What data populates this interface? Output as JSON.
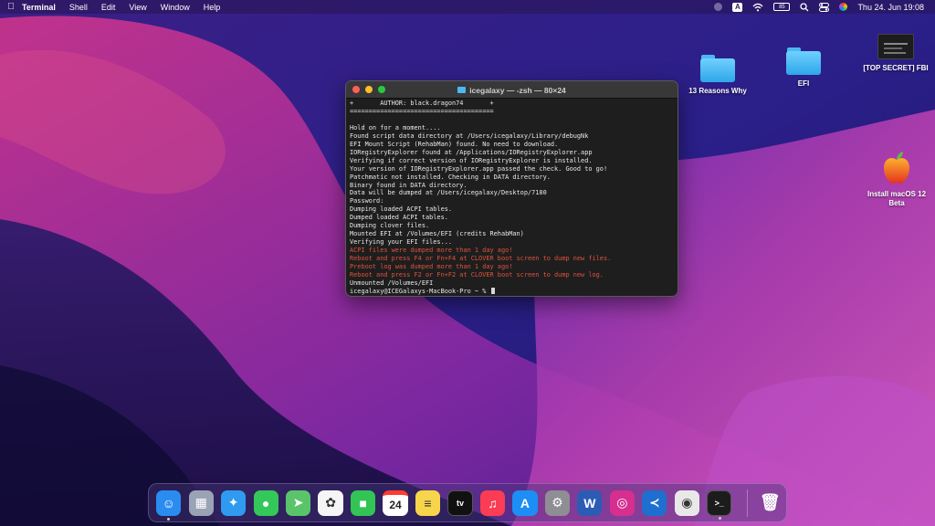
{
  "menubar": {
    "app_name": "Terminal",
    "items": [
      "Shell",
      "Edit",
      "View",
      "Window",
      "Help"
    ],
    "clock": "Thu 24. Jun  19:08",
    "input_source": "A",
    "battery": "85"
  },
  "desktop": {
    "icons": [
      {
        "label": "13 Reasons Why",
        "icon": "folder-icon"
      },
      {
        "label": "EFI",
        "icon": "folder-icon"
      },
      {
        "label": "[TOP SECRET] FBI",
        "icon": "screenshot-thumbnail-icon"
      },
      {
        "label": "Install macOS 12 Beta",
        "icon": "macos-installer-icon"
      }
    ]
  },
  "terminal": {
    "title": "icegalaxy — -zsh — 80×24",
    "lines": [
      {
        "text": "+       AUTHOR: black.dragon74       +",
        "color": "normal"
      },
      {
        "text": "======================================",
        "color": "normal"
      },
      {
        "text": "",
        "color": "normal"
      },
      {
        "text": "Hold on for a moment....",
        "color": "normal"
      },
      {
        "text": "Found script data directory at /Users/icegalaxy/Library/debugNk",
        "color": "normal"
      },
      {
        "text": "EFI Mount Script (RehabMan) found. No need to download.",
        "color": "normal"
      },
      {
        "text": "IORegistryExplorer found at /Applications/IORegistryExplorer.app",
        "color": "normal"
      },
      {
        "text": "Verifying if correct version of IORegistryExplorer is installed.",
        "color": "normal"
      },
      {
        "text": "Your version of IORegistryExplorer.app passed the check. Good to go!",
        "color": "normal"
      },
      {
        "text": "Patchmatic not installed. Checking in DATA directory.",
        "color": "normal"
      },
      {
        "text": "Binary found in DATA directory.",
        "color": "normal"
      },
      {
        "text": "Data will be dumped at /Users/icegalaxy/Desktop/7180",
        "color": "normal"
      },
      {
        "text": "Password:",
        "color": "normal"
      },
      {
        "text": "Dumping loaded ACPI tables.",
        "color": "normal"
      },
      {
        "text": "Dumped loaded ACPI tables.",
        "color": "normal"
      },
      {
        "text": "Dumping clover files.",
        "color": "normal"
      },
      {
        "text": "Mounted EFI at /Volumes/EFI (credits RehabMan)",
        "color": "normal"
      },
      {
        "text": "Verifying your EFI files...",
        "color": "normal"
      },
      {
        "text": "ACPI files were dumped more than 1 day ago!",
        "color": "red"
      },
      {
        "text": "Reboot and press F4 or Fn+F4 at CLOVER boot screen to dump new files.",
        "color": "red"
      },
      {
        "text": "Preboot log was dumped more than 1 day ago!",
        "color": "red"
      },
      {
        "text": "Reboot and press F2 or Fn+F2 at CLOVER boot screen to dump new log.",
        "color": "red"
      },
      {
        "text": "Unmounted /Volumes/EFI",
        "color": "normal"
      }
    ],
    "prompt": "icegalaxy@ICEGalaxys-MacBook-Pro ~ %"
  },
  "dock": {
    "apps": [
      {
        "name": "Finder",
        "icon": "finder-icon",
        "glyph": "☺",
        "bg": "#2b8cf0",
        "running": true
      },
      {
        "name": "Launchpad",
        "icon": "launchpad-icon",
        "glyph": "▦",
        "bg": "#9aa3b5",
        "running": false
      },
      {
        "name": "Safari",
        "icon": "safari-icon",
        "glyph": "✦",
        "bg": "#2e9bf0",
        "running": false
      },
      {
        "name": "Messages",
        "icon": "messages-icon",
        "glyph": "●",
        "bg": "#34c759",
        "running": false
      },
      {
        "name": "Maps",
        "icon": "maps-icon",
        "glyph": "➤",
        "bg": "#5ac46a",
        "running": false
      },
      {
        "name": "Photos",
        "icon": "photos-icon",
        "glyph": "✿",
        "bg": "#f5f5f5",
        "running": false
      },
      {
        "name": "FaceTime",
        "icon": "facetime-icon",
        "glyph": "■",
        "bg": "#32c455",
        "running": false
      },
      {
        "name": "Calendar",
        "icon": "calendar-icon",
        "glyph": "24",
        "bg": "#ffffff",
        "running": false
      },
      {
        "name": "Notes",
        "icon": "notes-icon",
        "glyph": "≡",
        "bg": "#f7d54a",
        "running": false
      },
      {
        "name": "TV",
        "icon": "apple-tv-icon",
        "glyph": "tv",
        "bg": "#111111",
        "running": false
      },
      {
        "name": "Music",
        "icon": "music-icon",
        "glyph": "♫",
        "bg": "#fa3c54",
        "running": false
      },
      {
        "name": "App Store",
        "icon": "app-store-icon",
        "glyph": "A",
        "bg": "#1c8ef5",
        "running": false
      },
      {
        "name": "System Preferences",
        "icon": "system-preferences-icon",
        "glyph": "⚙",
        "bg": "#8e8e93",
        "running": false
      },
      {
        "name": "Word",
        "icon": "word-icon",
        "glyph": "W",
        "bg": "#2b5cb5",
        "running": false
      },
      {
        "name": "Instagram",
        "icon": "instagram-icon",
        "glyph": "◎",
        "bg": "#d62f8f",
        "running": false
      },
      {
        "name": "Visual Studio Code",
        "icon": "vscode-icon",
        "glyph": "≺",
        "bg": "#1f6fd0",
        "running": false
      },
      {
        "name": "Screenshot",
        "icon": "screenshot-icon",
        "glyph": "◉",
        "bg": "#e8e8e8",
        "running": false
      },
      {
        "name": "Terminal",
        "icon": "terminal-icon",
        "glyph": ">_",
        "bg": "#1c1c1c",
        "running": true
      }
    ],
    "trash": {
      "name": "Trash",
      "icon": "trash-icon",
      "glyph": "🗑"
    }
  },
  "colors": {
    "terminal_bg": "#1e1e1e",
    "terminal_red": "#e0533d",
    "wallpaper_accent": "#b63fb0"
  }
}
